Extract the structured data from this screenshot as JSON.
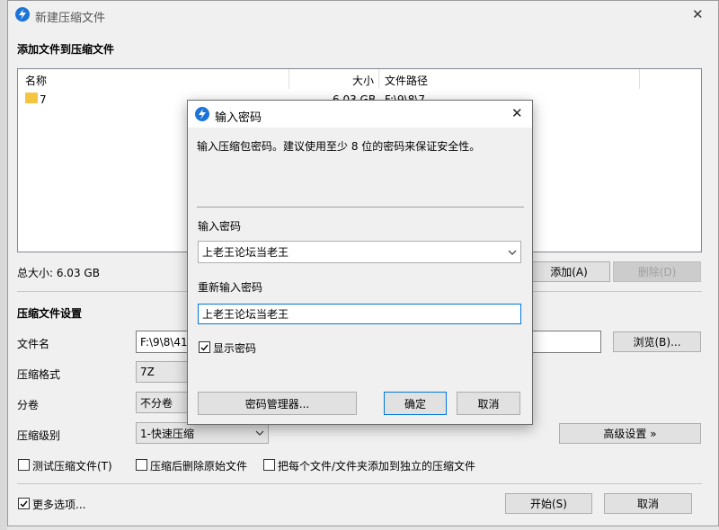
{
  "window": {
    "title": "新建压缩文件",
    "close_glyph": "✕"
  },
  "files": {
    "section_title": "添加文件到压缩文件",
    "columns": {
      "name": "名称",
      "size": "大小",
      "path": "文件路径"
    },
    "rows": [
      {
        "name": "7",
        "size": "6.03 GB",
        "path": "F:\\9\\8\\7"
      }
    ],
    "total_label": "总大小: 6.03 GB",
    "add_button": "添加(A)",
    "delete_button": "删除(D)"
  },
  "settings": {
    "section_title": "压缩文件设置",
    "filename_label": "文件名",
    "filename_value": "F:\\9\\8\\41",
    "browse_button": "浏览(B)...",
    "format_label": "压缩格式",
    "format_value": "7Z",
    "split_label": "分卷",
    "split_value": "不分卷",
    "level_label": "压缩级别",
    "level_value": "1-快速压缩",
    "advanced_button": "高级设置 »",
    "test_checkbox": "测试压缩文件(T)",
    "delete_after_checkbox": "压缩后删除原始文件",
    "separate_checkbox": "把每个文件/文件夹添加到独立的压缩文件",
    "more_options": "更多选项...",
    "start_button": "开始(S)",
    "cancel_button": "取消"
  },
  "dialog": {
    "title": "输入密码",
    "description": "输入压缩包密码。建议使用至少 8 位的密码来保证安全性。",
    "password_label": "输入密码",
    "password_value": "上老王论坛当老王",
    "confirm_label": "重新输入密码",
    "confirm_value": "上老王论坛当老王",
    "show_password": "显示密码",
    "show_password_checked": true,
    "manager_button": "密码管理器...",
    "ok_button": "确定",
    "cancel_button": "取消",
    "close_glyph": "✕"
  },
  "colors": {
    "accent": "#0078d7",
    "folder": "#f5c542",
    "app_icon": "#1a74d9"
  }
}
